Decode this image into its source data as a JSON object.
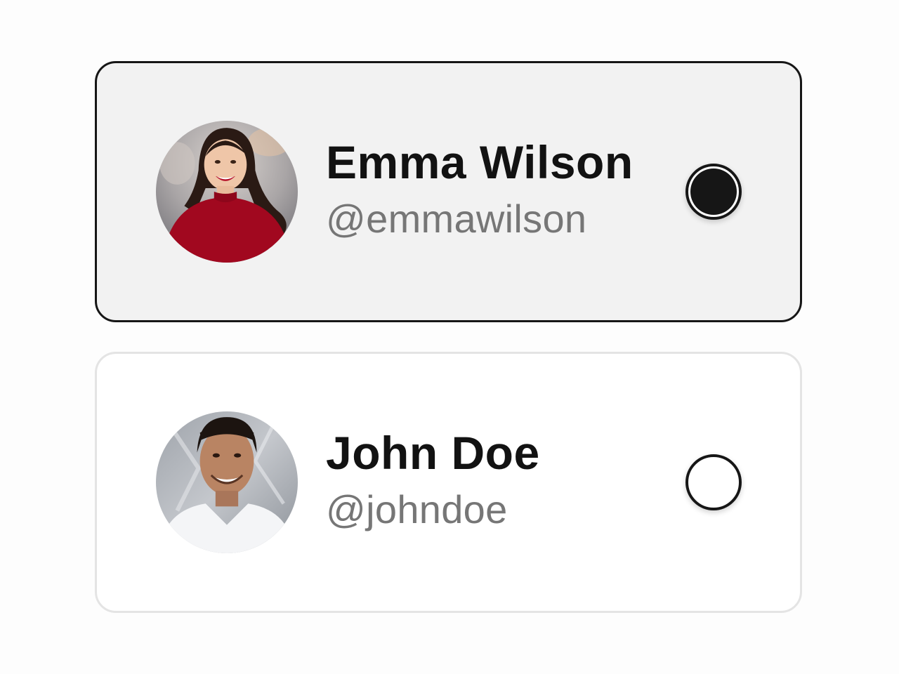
{
  "accounts": [
    {
      "name": "Emma Wilson",
      "handle": "@emmawilson",
      "selected": true,
      "avatar_icon": "woman-red-sweater-photo"
    },
    {
      "name": "John Doe",
      "handle": "@johndoe",
      "selected": false,
      "avatar_icon": "man-white-tshirt-photo"
    }
  ],
  "colors": {
    "selected_border": "#161616",
    "selected_background": "#f2f2f2",
    "unselected_border": "#e4e4e4",
    "name_text": "#121212",
    "handle_text": "#767676"
  }
}
